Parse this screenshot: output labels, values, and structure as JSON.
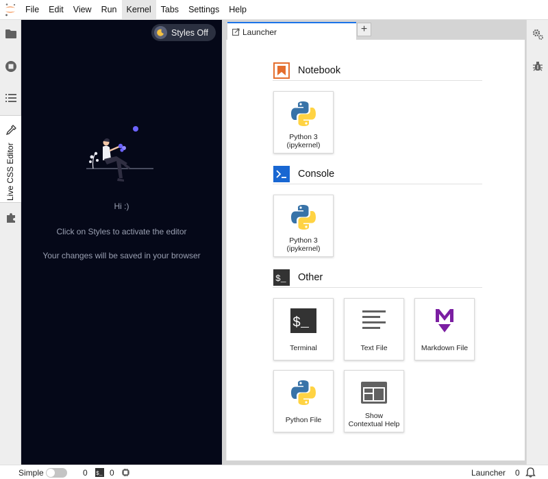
{
  "menubar": {
    "items": [
      "File",
      "Edit",
      "View",
      "Run",
      "Kernel",
      "Tabs",
      "Settings",
      "Help"
    ],
    "active": "Kernel"
  },
  "leftbar": {
    "icons": [
      "folder-icon",
      "stop-circle-icon",
      "list-icon",
      "dropper-icon",
      "puzzle-icon"
    ],
    "live_css_label": "Live CSS Editor"
  },
  "live_panel": {
    "styles_button": "Styles Off",
    "greeting": "Hi :)",
    "instruction": "Click on Styles to activate the editor",
    "saved_note": "Your changes will be saved in your browser"
  },
  "tabs": [
    {
      "label": "Launcher",
      "active": true
    }
  ],
  "tab_add": "+",
  "launcher": {
    "sections": [
      {
        "title": "Notebook",
        "icon": "notebook-icon",
        "cards": [
          {
            "line1": "Python 3",
            "line2": "(ipykernel)",
            "icon": "python-icon"
          }
        ]
      },
      {
        "title": "Console",
        "icon": "console-icon",
        "cards": [
          {
            "line1": "Python 3",
            "line2": "(ipykernel)",
            "icon": "python-icon"
          }
        ]
      },
      {
        "title": "Other",
        "icon": "terminal-icon",
        "cards": [
          {
            "line1": "Terminal",
            "line2": "",
            "icon": "terminal-icon"
          },
          {
            "line1": "Text File",
            "line2": "",
            "icon": "text-file-icon"
          },
          {
            "line1": "Markdown File",
            "line2": "",
            "icon": "markdown-icon"
          },
          {
            "line1": "Python File",
            "line2": "",
            "icon": "python-icon"
          },
          {
            "line1": "Show",
            "line2": "Contextual Help",
            "icon": "contextual-help-icon"
          }
        ]
      }
    ]
  },
  "rightbar": {
    "icons": [
      "property-inspector-icon",
      "debugger-icon"
    ]
  },
  "statusbar": {
    "simple_label": "Simple",
    "simple_on": false,
    "kernels_count": "0",
    "terminals_count": "0",
    "activity_label": "Launcher",
    "notifications_count": "0"
  },
  "colors": {
    "panel_bg": "#050818",
    "tab_accent": "#1a73e8",
    "notebook_orange": "#e46e2e",
    "console_blue": "#1967d2",
    "markdown_purple": "#7b1fa2",
    "python_blue": "#3873a8",
    "python_yellow": "#ffd343"
  }
}
